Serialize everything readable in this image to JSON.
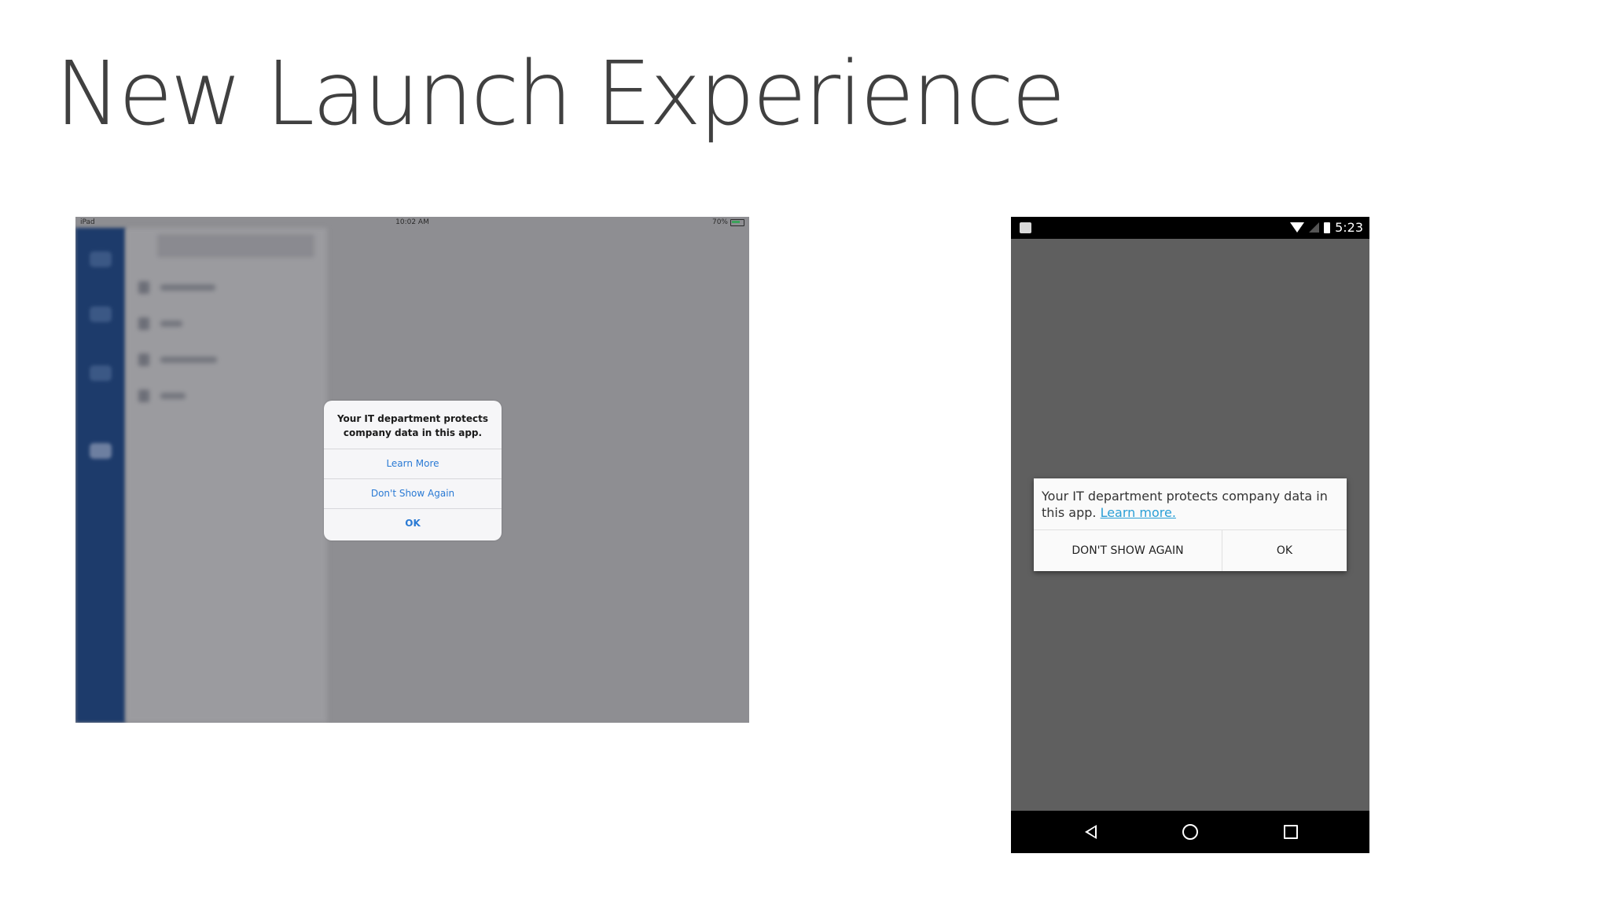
{
  "slide": {
    "title": "New Launch Experience"
  },
  "ipad": {
    "status_bar": {
      "carrier": "iPad",
      "time": "10:02 AM",
      "battery": "70%"
    },
    "alert": {
      "message": "Your IT department protects company data in this app.",
      "learn_more": "Learn More",
      "dont_show_again": "Don't Show Again",
      "ok": "OK"
    }
  },
  "android": {
    "status_bar": {
      "time": "5:23"
    },
    "dialog": {
      "message": "Your IT department protects company data in this app.",
      "learn_more_link": "Learn more.",
      "dont_show_again": "DON'T SHOW AGAIN",
      "ok": "OK"
    },
    "nav_bar": {
      "icons": [
        "back-icon",
        "home-icon",
        "recents-icon"
      ]
    }
  },
  "colors": {
    "ios_tint": "#2a7ad4",
    "android_link": "#2a9fd6",
    "ipad_rail": "#1d3b6b",
    "android_scrim": "#5f5f5f"
  }
}
